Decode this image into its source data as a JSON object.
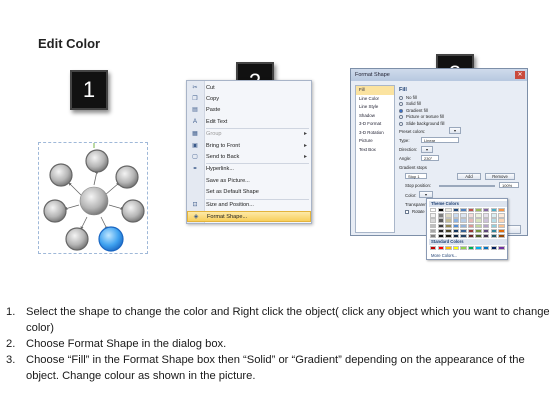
{
  "title": "Edit Color",
  "steps": [
    "1",
    "2",
    "3"
  ],
  "context_menu": {
    "items": [
      {
        "label": "Cut",
        "icon": "scissors-icon",
        "glyph": "✂"
      },
      {
        "label": "Copy",
        "icon": "copy-icon",
        "glyph": "❐"
      },
      {
        "label": "Paste",
        "icon": "paste-icon",
        "glyph": "▤"
      },
      {
        "label": "Edit Text",
        "icon": "edit-text-icon",
        "glyph": "A"
      },
      {
        "label": "Group",
        "icon": "group-icon",
        "glyph": "▦",
        "disabled": true,
        "submenu": true
      },
      {
        "label": "Bring to Front",
        "icon": "bring-front-icon",
        "glyph": "▣",
        "submenu": true
      },
      {
        "label": "Send to Back",
        "icon": "send-back-icon",
        "glyph": "▢",
        "submenu": true
      },
      {
        "label": "Hyperlink...",
        "icon": "hyperlink-icon",
        "glyph": "⚭"
      },
      {
        "label": "Save as Picture...",
        "icon": "",
        "glyph": ""
      },
      {
        "label": "Set as Default Shape",
        "icon": "",
        "glyph": ""
      },
      {
        "label": "Size and Position...",
        "icon": "size-position-icon",
        "glyph": "⊡"
      },
      {
        "label": "Format Shape...",
        "icon": "format-shape-icon",
        "glyph": "◈",
        "highlighted": true
      }
    ]
  },
  "dialog": {
    "title": "Format Shape",
    "close_glyph": "✕",
    "categories": [
      "Fill",
      "Line Color",
      "Line Style",
      "Shadow",
      "3-D Format",
      "3-D Rotation",
      "Picture",
      "Text Box"
    ],
    "selected_category": "Fill",
    "fill_heading": "Fill",
    "fill_options": [
      {
        "label": "No fill",
        "selected": false
      },
      {
        "label": "Solid fill",
        "selected": false
      },
      {
        "label": "Gradient fill",
        "selected": true
      },
      {
        "label": "Picture or texture fill",
        "selected": false
      },
      {
        "label": "Slide background fill",
        "selected": false
      }
    ],
    "preset_colors_label": "Preset colors:",
    "type_label": "Type:",
    "type_value": "Linear",
    "direction_label": "Direction:",
    "angle_label": "Angle:",
    "angle_value": "230°",
    "gradient_stops_label": "Gradient stops",
    "stop_value": "Stop 1",
    "add_button": "Add",
    "remove_button": "Remove",
    "stop_position_label": "Stop position:",
    "stop_position_value": "100%",
    "color_label": "Color:",
    "transparency_label": "Transparency:",
    "rotate_label": "Rotate with shape",
    "close_button": "Close"
  },
  "palette": {
    "theme_heading": "Theme Colors",
    "standard_heading": "Standard Colors",
    "more_colors": "More Colors...",
    "theme_top": [
      "#ffffff",
      "#000000",
      "#eeece1",
      "#1f497d",
      "#4f81bd",
      "#c0504d",
      "#9bbb59",
      "#8064a2",
      "#4bacc6",
      "#f79646"
    ],
    "theme_rows": [
      [
        "#f2f2f2",
        "#7f7f7f",
        "#ddd9c3",
        "#c6d9f0",
        "#dbe5f1",
        "#f2dcdb",
        "#ebf1dd",
        "#e5e0ec",
        "#dbeef3",
        "#fdeada"
      ],
      [
        "#d8d8d8",
        "#595959",
        "#c4bd97",
        "#8db3e2",
        "#b8cce4",
        "#e5b9b7",
        "#d7e3bc",
        "#ccc1d9",
        "#b7dde8",
        "#fbd5b5"
      ],
      [
        "#bfbfbf",
        "#3f3f3f",
        "#938953",
        "#548dd4",
        "#95b3d7",
        "#d99694",
        "#c3d69b",
        "#b2a2c7",
        "#92cddc",
        "#fac08f"
      ],
      [
        "#a5a5a5",
        "#262626",
        "#494429",
        "#17365d",
        "#366092",
        "#953734",
        "#76923c",
        "#5f497a",
        "#31859b",
        "#e36c09"
      ],
      [
        "#7f7f7f",
        "#0c0c0c",
        "#1d1b10",
        "#0f243e",
        "#244061",
        "#632423",
        "#4f6128",
        "#3f3151",
        "#205867",
        "#974806"
      ]
    ],
    "standard": [
      "#c00000",
      "#ff0000",
      "#ffc000",
      "#ffff00",
      "#92d050",
      "#00b050",
      "#00b0f0",
      "#0070c0",
      "#002060",
      "#7030a0"
    ]
  },
  "instructions": [
    {
      "num": "1.",
      "text": "Select the shape to change the color and Right click the object( click any object which you want to change color)"
    },
    {
      "num": "2.",
      "text": "Choose Format Shape in the dialog box."
    },
    {
      "num": "3.",
      "text": "Choose “Fill” in the Format Shape box then “Solid” or “Gradient” depending on the appearance of the object. Change colour as shown in the picture."
    }
  ],
  "colors": {
    "highlight_circle": "#2f8fe8",
    "circle_gray": "#9a9a9a"
  }
}
